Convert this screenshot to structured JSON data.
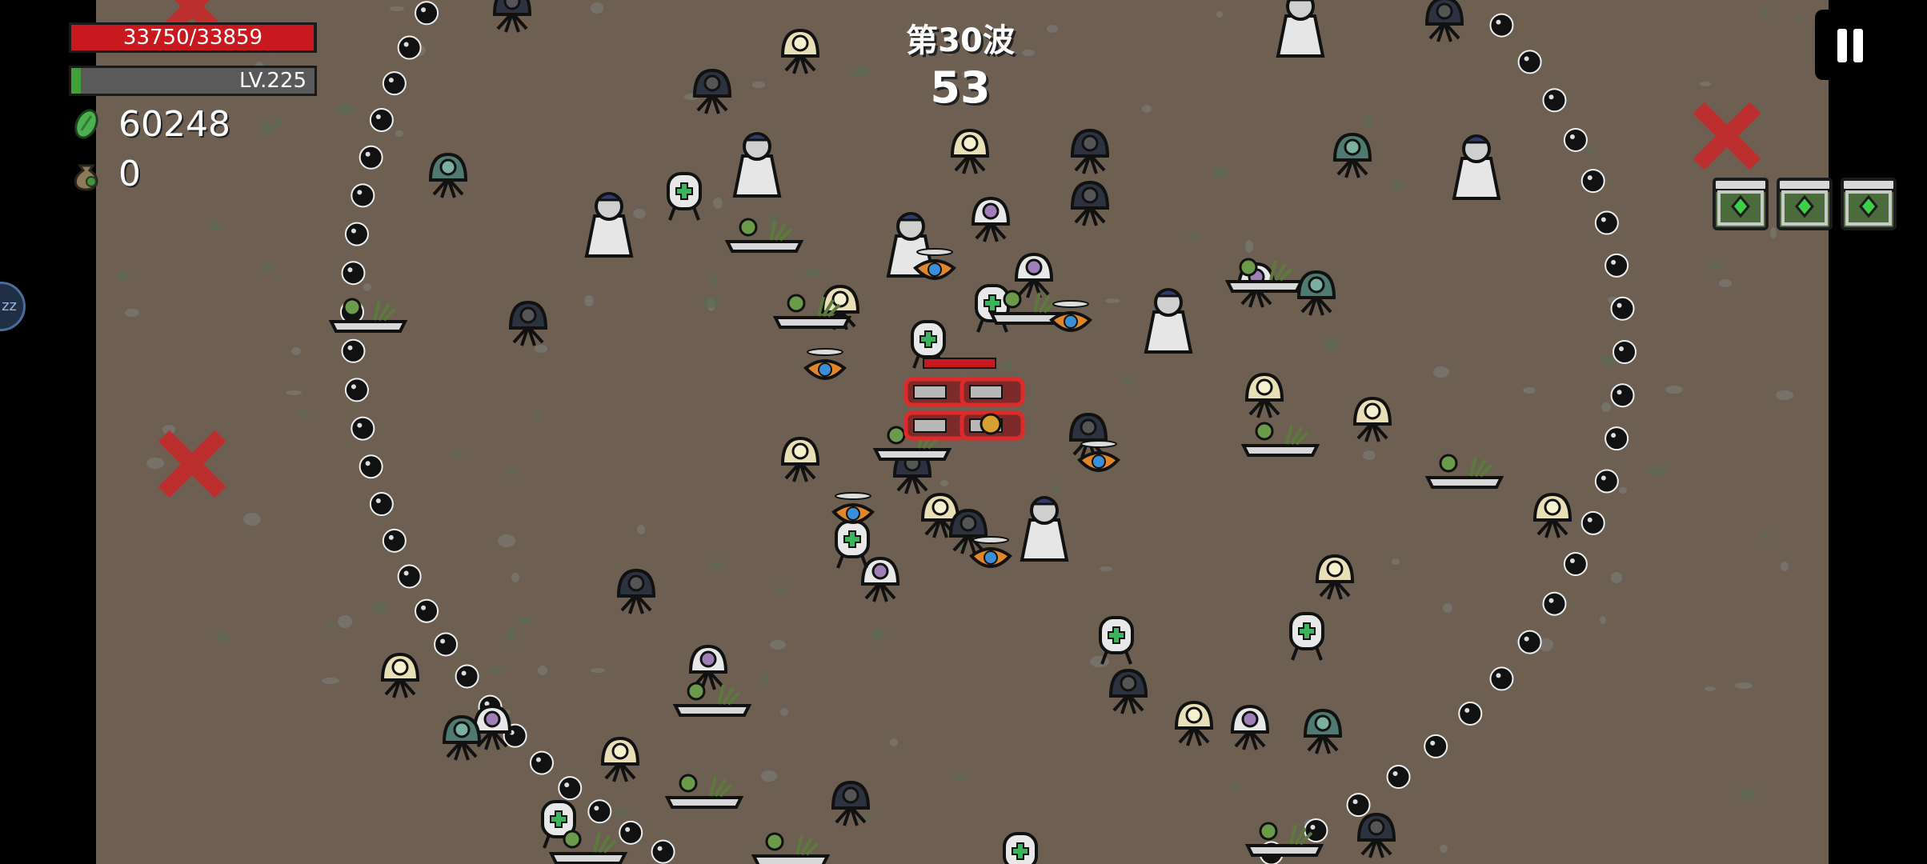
{
  "hud": {
    "hp": {
      "text": "33750/33859",
      "current": 33750,
      "max": 33859
    },
    "level": {
      "text": "LV.225",
      "progress": 0.04
    },
    "currency": {
      "icon": "green-material-icon",
      "value": "60248"
    },
    "bag": {
      "icon": "money-bag-icon",
      "value": "0"
    }
  },
  "wave": {
    "title": "第30波",
    "timer": "53"
  },
  "side_badge": {
    "text": "zz"
  },
  "colors": {
    "ground": "#6e5f53",
    "border": "#000000",
    "hp": "#c81a1e",
    "xp": "#3ea13a",
    "loot_gem": "#3ecf4a",
    "enemy_outline": "#e02a2a"
  },
  "pickups": {
    "crates": 3,
    "icon": "loot-crate-icon"
  }
}
